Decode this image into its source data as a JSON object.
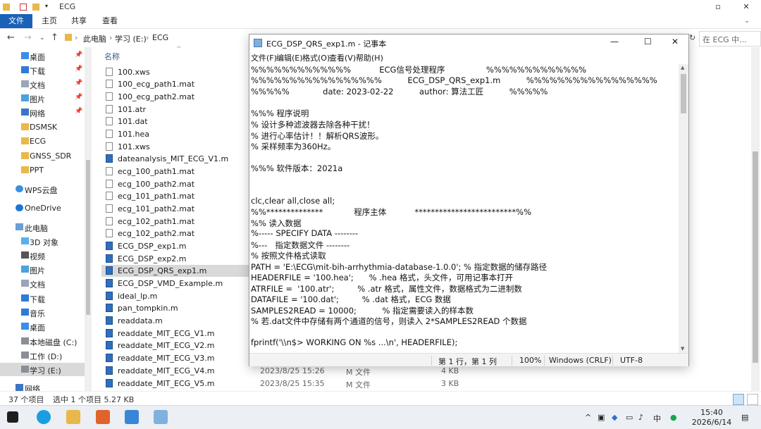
{
  "explorer": {
    "title": "ECG",
    "ribbon_tabs": [
      "文件",
      "主页",
      "共享",
      "查看"
    ],
    "breadcrumb": [
      "此电脑",
      "学习 (E:)",
      "ECG"
    ],
    "search_placeholder": "在 ECG 中...",
    "nav_items": [
      {
        "label": "桌面",
        "pinned": true
      },
      {
        "label": "下载",
        "pinned": true
      },
      {
        "label": "文档",
        "pinned": true
      },
      {
        "label": "图片",
        "pinned": true
      },
      {
        "label": "网络",
        "pinned": true
      },
      {
        "label": "DSMSK",
        "pinned": false
      },
      {
        "label": "ECG",
        "pinned": false
      },
      {
        "label": "GNSS_SDR",
        "pinned": false
      },
      {
        "label": "PPT",
        "pinned": false
      },
      {
        "label": "WPS云盘",
        "pinned": false
      },
      {
        "label": "OneDrive",
        "pinned": false
      },
      {
        "label": "此电脑",
        "pinned": false
      },
      {
        "label": "3D 对象",
        "pinned": false
      },
      {
        "label": "视频",
        "pinned": false
      },
      {
        "label": "图片",
        "pinned": false
      },
      {
        "label": "文档",
        "pinned": false
      },
      {
        "label": "下载",
        "pinned": false
      },
      {
        "label": "音乐",
        "pinned": false
      },
      {
        "label": "桌面",
        "pinned": false
      },
      {
        "label": "本地磁盘 (C:)",
        "pinned": false
      },
      {
        "label": "工作 (D:)",
        "pinned": false
      },
      {
        "label": "学习 (E:)",
        "pinned": false
      },
      {
        "label": "网络",
        "pinned": false
      }
    ],
    "column_name": "名称",
    "files": [
      {
        "name": "100.xws",
        "type": "file"
      },
      {
        "name": "100_ecg_path1.mat",
        "type": "file"
      },
      {
        "name": "100_ecg_path2.mat",
        "type": "file"
      },
      {
        "name": "101.atr",
        "type": "file"
      },
      {
        "name": "101.dat",
        "type": "file"
      },
      {
        "name": "101.hea",
        "type": "file"
      },
      {
        "name": "101.xws",
        "type": "file"
      },
      {
        "name": "dateanalysis_MIT_ECG_V1.m",
        "type": "m"
      },
      {
        "name": "ecg_100_path1.mat",
        "type": "file"
      },
      {
        "name": "ecg_100_path2.mat",
        "type": "file"
      },
      {
        "name": "ecg_101_path1.mat",
        "type": "file"
      },
      {
        "name": "ecg_101_path2.mat",
        "type": "file"
      },
      {
        "name": "ecg_102_path1.mat",
        "type": "file"
      },
      {
        "name": "ecg_102_path2.mat",
        "type": "file"
      },
      {
        "name": "ECG_DSP_exp1.m",
        "type": "m"
      },
      {
        "name": "ECG_DSP_exp2.m",
        "type": "m"
      },
      {
        "name": "ECG_DSP_QRS_exp1.m",
        "type": "m",
        "selected": true
      },
      {
        "name": "ECG_DSP_VMD_Example.m",
        "type": "m"
      },
      {
        "name": "ideal_lp.m",
        "type": "m"
      },
      {
        "name": "pan_tompkin.m",
        "type": "m"
      },
      {
        "name": "readdata.m",
        "type": "m"
      },
      {
        "name": "readdate_MIT_ECG_V1.m",
        "type": "m"
      },
      {
        "name": "readdate_MIT_ECG_V2.m",
        "type": "m"
      },
      {
        "name": "readdate_MIT_ECG_V3.m",
        "type": "m"
      },
      {
        "name": "readdate_MIT_ECG_V4.m",
        "type": "m"
      },
      {
        "name": "readdate_MIT_ECG_V5.m",
        "type": "m"
      }
    ],
    "visible_meta": [
      {
        "date": "2023/8/25 15:26",
        "type": "M 文件",
        "size": "4 KB"
      },
      {
        "date": "2023/8/25 15:35",
        "type": "M 文件",
        "size": "3 KB"
      }
    ],
    "status_count": "37 个项目",
    "status_selected": "选中 1 个项目  5.27 KB"
  },
  "notepad": {
    "title": "ECG_DSP_QRS_exp1.m - 记事本",
    "menu": [
      "文件(F)",
      "编辑(E)",
      "格式(O)",
      "查看(V)",
      "帮助(H)"
    ],
    "lines": [
      "%%%%%%%%%%%%%           ECG信号处理程序                %%%%%%%%%%%%%",
      "%%%%%%%%%%%%%%%%%          ECG_DSP_QRS_exp1.m          %%%%%%%%%%%%%%%%%",
      "%%%%%             date: 2023-02-22          author: 算法工匠          %%%%%",
      "",
      "%%% 程序说明",
      "% 设计多种滤波器去除各种干扰！",
      "% 进行心率估计！！解析QRS波形。",
      "% 采样频率为360Hz。",
      "",
      "%%% 软件版本：2021a",
      "",
      "",
      "clc,clear all,close all;",
      "%%**************            程序主体           *************************%%",
      "%% 读入数据",
      "%----- SPECIFY DATA --------",
      "%---   指定数据文件 --------",
      "% 按照文件格式读取",
      "PATH = 'E:\\ECG\\mit-bih-arrhythmia-database-1.0.0'; % 指定数据的储存路径",
      "HEADERFILE = '100.hea';      % .hea 格式，头文件，可用记事本打开",
      "ATRFILE =  '100.atr';         % .atr 格式，属性文件，数据格式为二进制数",
      "DATAFILE = '100.dat';         % .dat 格式，ECG 数据",
      "SAMPLES2READ = 10000;          % 指定需要读入的样本数",
      "% 若.dat文件中存储有两个通道的信号，则读入 2*SAMPLES2READ 个数据",
      "",
      "fprintf('\\\\n$> WORKING ON %s ...\\n', HEADERFILE);"
    ],
    "status": {
      "position": "第 1 行，第 1 列",
      "zoom": "100%",
      "line_ending": "Windows (CRLF)",
      "encoding": "UTF-8"
    }
  },
  "taskbar": {
    "ime": "中",
    "time": "15:40",
    "date": "2026/6/14"
  },
  "colors": {
    "accent": "#1a62b8",
    "selection": "#d9d9d9"
  }
}
